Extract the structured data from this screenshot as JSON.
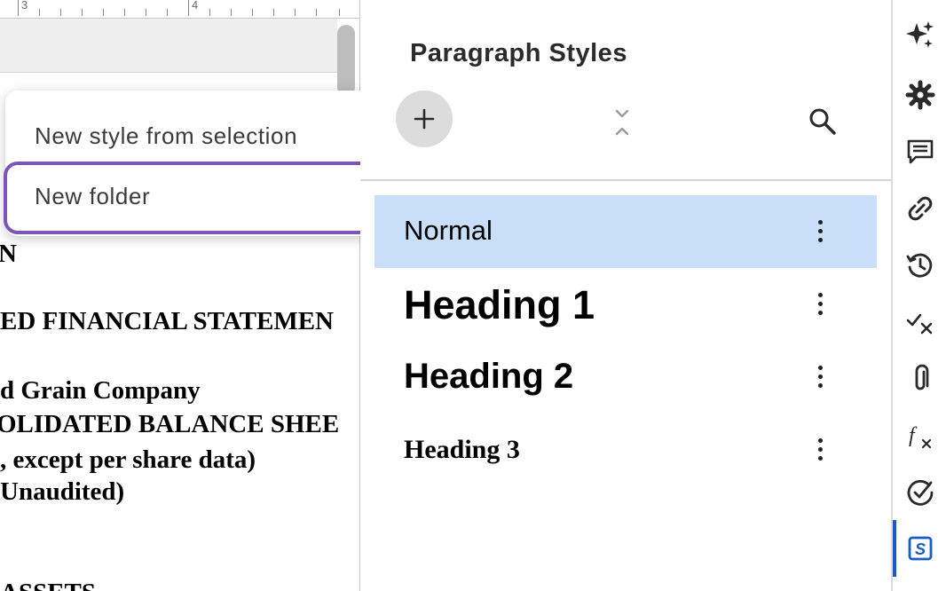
{
  "ruler": {
    "marks": [
      "3",
      "4"
    ]
  },
  "document": {
    "lines": [
      "N",
      "ED FINANCIAL STATEMEN",
      "d Grain Company",
      "OLIDATED BALANCE SHEE",
      ", except per share data)",
      "Unaudited)",
      "ASSETS"
    ]
  },
  "menu": {
    "items": [
      {
        "label": "New style from selection"
      },
      {
        "label": "New folder"
      }
    ]
  },
  "panel": {
    "title": "Paragraph Styles",
    "add_icon": "plus-icon",
    "collapse_icon": "collapse-all-icon",
    "search_icon": "search-icon",
    "styles": [
      {
        "name": "Normal",
        "selected": true
      },
      {
        "name": "Heading 1",
        "selected": false
      },
      {
        "name": "Heading 2",
        "selected": false
      },
      {
        "name": "Heading 3",
        "selected": false
      }
    ]
  },
  "sidebar": {
    "icons": [
      "sparkle-icon",
      "gear-icon",
      "comment-icon",
      "link-icon",
      "history-icon",
      "track-changes-icon",
      "paperclip-icon",
      "function-icon",
      "check-circle-icon",
      "styles-icon"
    ],
    "active": "styles-icon",
    "accent": "#1a5dc0"
  },
  "colors": {
    "selection_highlight": "#c9def8",
    "menu_focus_ring": "#7c56b7",
    "add_button_bg": "#dcdcdc"
  }
}
